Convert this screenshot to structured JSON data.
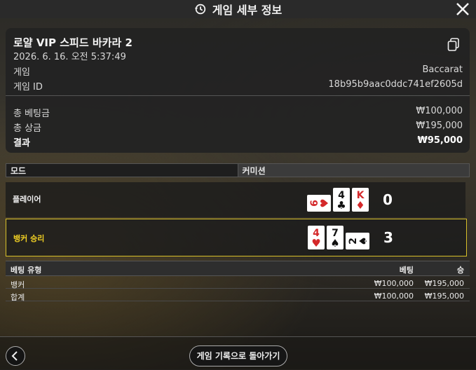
{
  "header": {
    "title": "게임 세부 정보",
    "history_icon": "history-clock-icon",
    "close_icon": "close-icon"
  },
  "game": {
    "name": "로얄 VIP 스피드 바카라 2",
    "datetime": "2026. 6. 16. 오전 5:37:49",
    "game_label": "게임",
    "game_value": "Baccarat",
    "id_label": "게임 ID",
    "id_value": "18b95b9aac0ddc741ef2605d",
    "copy_icon": "copy-icon"
  },
  "totals": {
    "bet_label": "총 베팅금",
    "bet_value": "₩100,000",
    "win_label": "총 상금",
    "win_value": "₩195,000",
    "result_label": "결과",
    "result_value": "₩95,000"
  },
  "mode": {
    "left": "모드",
    "right": "커미션"
  },
  "player": {
    "label": "플레이어",
    "score": "0",
    "cards": [
      {
        "rank": "6",
        "suit": "♥",
        "color": "#d4282a",
        "sideways": true
      },
      {
        "rank": "4",
        "suit": "♣",
        "color": "#111111",
        "sideways": false
      },
      {
        "rank": "K",
        "suit": "♦",
        "color": "#d4282a",
        "sideways": false
      }
    ]
  },
  "banker": {
    "label": "뱅커 승리",
    "score": "3",
    "cards": [
      {
        "rank": "4",
        "suit": "♥",
        "color": "#d4282a",
        "sideways": false
      },
      {
        "rank": "7",
        "suit": "♠",
        "color": "#111111",
        "sideways": false
      },
      {
        "rank": "2",
        "suit": "♠",
        "color": "#111111",
        "sideways": true
      }
    ]
  },
  "bets": {
    "headers": {
      "type": "베팅 유형",
      "bet": "베팅",
      "win": "승"
    },
    "rows": [
      {
        "type": "뱅커",
        "bet": "₩100,000",
        "win": "₩195,000"
      },
      {
        "type": "합계",
        "bet": "₩100,000",
        "win": "₩195,000"
      }
    ]
  },
  "footer": {
    "back_icon": "chevron-left-icon",
    "history_button": "게임 기록으로 돌아가기"
  },
  "colors": {
    "banker_highlight": "#d8c02a",
    "banker_label": "#f0cf24",
    "red_suit": "#d4282a"
  }
}
